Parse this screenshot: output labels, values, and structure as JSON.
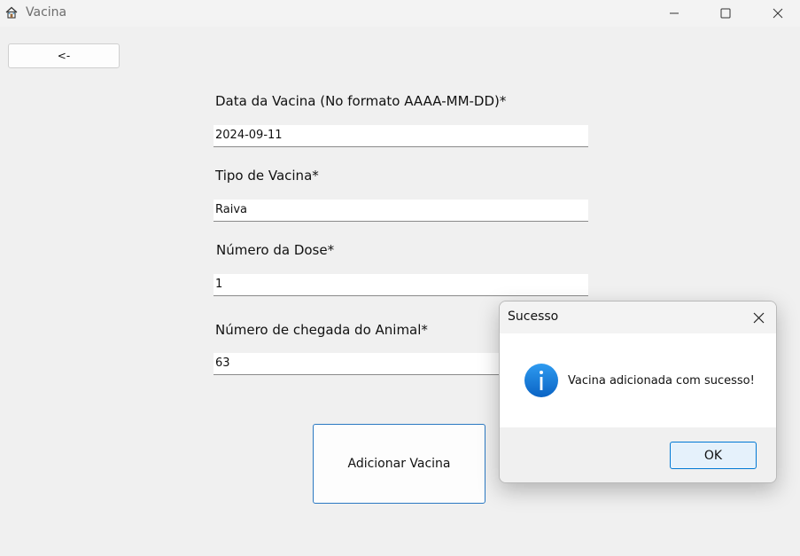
{
  "window": {
    "title": "Vacina",
    "icon": "house-icon"
  },
  "back_button": {
    "label": "<-"
  },
  "form": {
    "fields": [
      {
        "label": "Data da Vacina (No formato AAAA-MM-DD)*",
        "value": "2024-09-11"
      },
      {
        "label": "Tipo de Vacina*",
        "value": "Raiva"
      },
      {
        "label": "Número da Dose*",
        "value": "1"
      },
      {
        "label": "Número de chegada do Animal*",
        "value": "63"
      }
    ],
    "submit_label": "Adicionar Vacina"
  },
  "dialog": {
    "title": "Sucesso",
    "message": "Vacina adicionada com sucesso!",
    "ok_label": "OK",
    "icon": "info-icon",
    "accent_color": "#0078d4"
  }
}
